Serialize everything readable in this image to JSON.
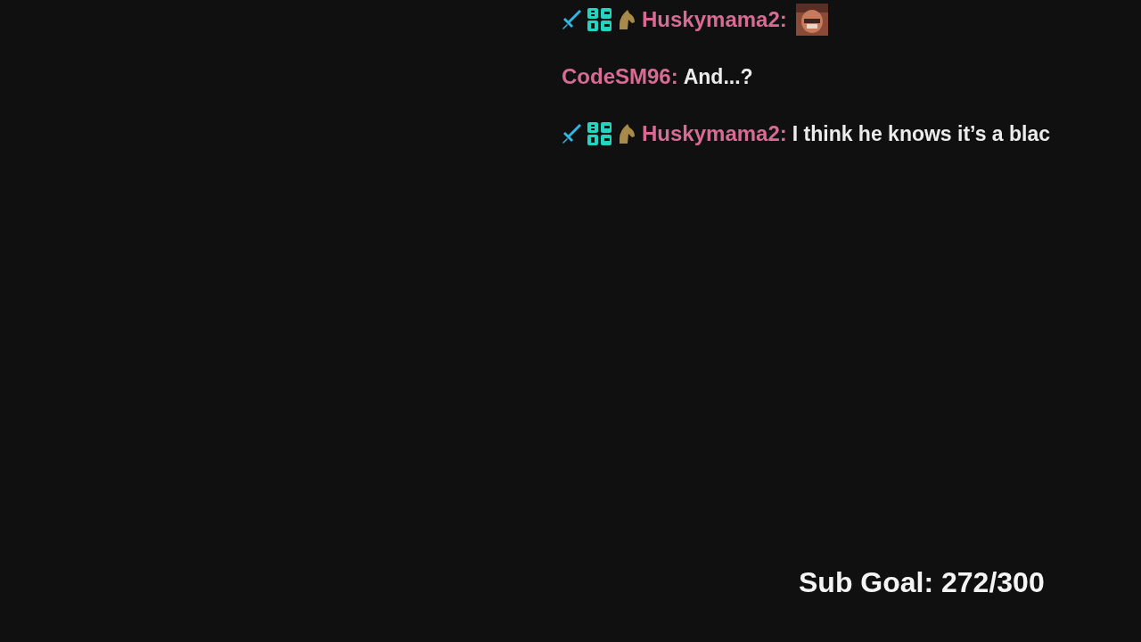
{
  "chat": [
    {
      "badges": [
        {
          "kind": "sword"
        },
        {
          "kind": "bits"
        },
        {
          "kind": "horse"
        }
      ],
      "user": "Huskymama2:",
      "emote": true
    },
    {
      "user": "CodeSM96:",
      "text": "And...?"
    },
    {
      "badges": [
        {
          "kind": "sword"
        },
        {
          "kind": "bits"
        },
        {
          "kind": "horse"
        }
      ],
      "user": "Huskymama2:",
      "text": "I think he knows it’s a blac"
    }
  ],
  "sub_goal": "Sub Goal: 272/300"
}
